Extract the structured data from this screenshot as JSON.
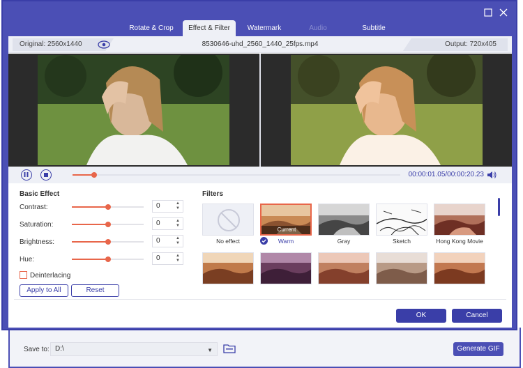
{
  "tabs": [
    {
      "label": "Rotate & Crop",
      "state": "normal"
    },
    {
      "label": "Effect & Filter",
      "state": "active"
    },
    {
      "label": "Watermark",
      "state": "normal"
    },
    {
      "label": "Audio",
      "state": "disabled"
    },
    {
      "label": "Subtitle",
      "state": "normal"
    }
  ],
  "infobar": {
    "original": "Original: 2560x1440",
    "filename": "8530646-uhd_2560_1440_25fps.mp4",
    "output": "Output: 720x405"
  },
  "player": {
    "time": "00:00:01.05/00:00:20.23",
    "progress_fraction": 0.065
  },
  "basic_effect": {
    "title": "Basic Effect",
    "rows": [
      {
        "label": "Contrast:",
        "value": "0",
        "level": 0.5
      },
      {
        "label": "Saturation:",
        "value": "0",
        "level": 0.5
      },
      {
        "label": "Brightness:",
        "value": "0",
        "level": 0.5
      },
      {
        "label": "Hue:",
        "value": "0",
        "level": 0.5
      }
    ],
    "deinterlacing": "Deinterlacing",
    "apply_all": "Apply to All",
    "reset": "Reset"
  },
  "filters": {
    "title": "Filters",
    "current_badge": "Current",
    "items": [
      {
        "label": "No effect",
        "tone": "none"
      },
      {
        "label": "Warm",
        "tone": "warm",
        "selected": true
      },
      {
        "label": "Gray",
        "tone": "gray"
      },
      {
        "label": "Sketch",
        "tone": "sketch"
      },
      {
        "label": "Hong Kong Movie",
        "tone": "hk"
      }
    ],
    "row2_tones": [
      "warm2",
      "purple",
      "warm3",
      "fade",
      "warm4"
    ]
  },
  "dialog": {
    "ok": "OK",
    "cancel": "Cancel"
  },
  "bottom": {
    "save_to": "Save to:",
    "path": "D:\\",
    "generate": "Generate GIF"
  },
  "colors": {
    "accent": "#4b4fb5",
    "slider": "#e8664a"
  }
}
